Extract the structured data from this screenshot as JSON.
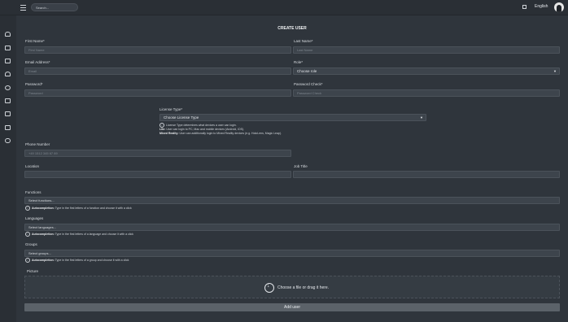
{
  "topbar": {
    "search_placeholder": "Search...",
    "language": "English"
  },
  "sidebar": {
    "icons": [
      "cloud-icon",
      "layers-icon",
      "copy-icon",
      "user-icon",
      "eye-icon",
      "clipboard-icon",
      "file-icon",
      "devices-icon",
      "database-icon"
    ]
  },
  "form": {
    "title": "CREATE USER",
    "first_name": {
      "label": "First Name*",
      "placeholder": "First Name"
    },
    "last_name": {
      "label": "Last Name*",
      "placeholder": "Last Name"
    },
    "email": {
      "label": "Email Address*",
      "placeholder": "Email"
    },
    "role": {
      "label": "Role*",
      "value": "Choose role"
    },
    "password": {
      "label": "Password*",
      "placeholder": "Password"
    },
    "password_check": {
      "label": "Password Check*",
      "placeholder": "Password Check"
    },
    "license": {
      "label": "License Type*",
      "value": "Choose License Type",
      "hint_main": "License Type determines what devices a user can login.",
      "hint_lite_label": "Lite:",
      "hint_lite_text": "User can login to PC, Mac and mobile devices (Android, iOS).",
      "hint_mr_label": "Mixed Reality:",
      "hint_mr_text": "User can additionally login to Mixed Reality devices (e.g. HoloLens, Magic Leap)."
    },
    "phone": {
      "label": "Phone Number",
      "placeholder": "+49 1512 345 67 89"
    },
    "location": {
      "label": "Location"
    },
    "job_title": {
      "label": "Job Title"
    },
    "functions": {
      "label": "Functions",
      "value": "Select functions...",
      "hint_label": "Autocompletion:",
      "hint_text": "Type in the first letters of a function and choose it with a click"
    },
    "languages": {
      "label": "Languages",
      "value": "Select languages...",
      "hint_label": "Autocompletion:",
      "hint_text": "Type in the first letters of a language and choose it with a click"
    },
    "groups": {
      "label": "Groups",
      "value": "Select groups...",
      "hint_label": "Autocompletion:",
      "hint_text": "Type in the first letters of a group and choose it with a click"
    },
    "picture": {
      "label": "Picture",
      "drop_text": "Choose a file or drag it here."
    },
    "submit_label": "Add user"
  }
}
